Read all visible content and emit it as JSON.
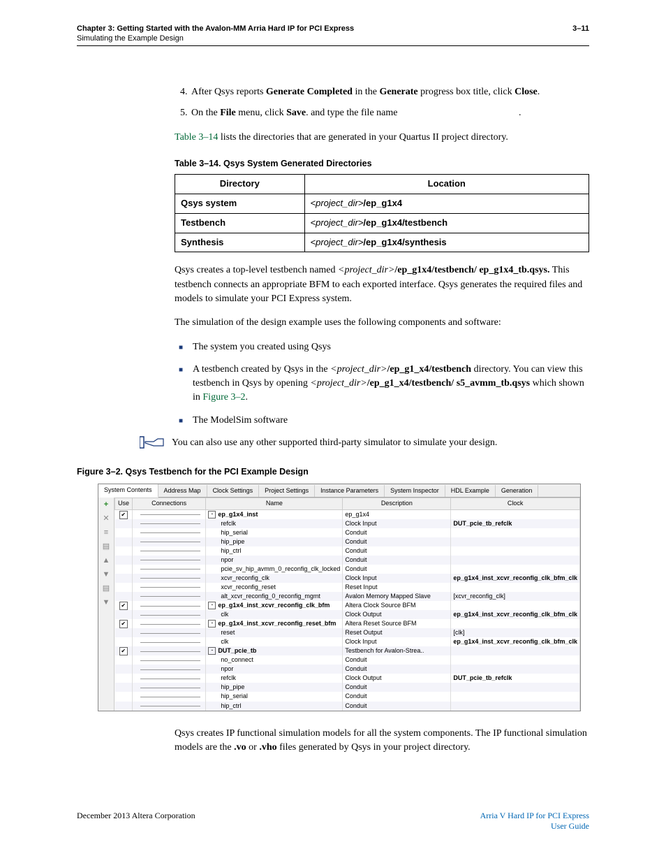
{
  "header": {
    "chapter_line": "Chapter 3:  Getting Started with the Avalon-MM Arria Hard IP for PCI Express",
    "sub_line": "Simulating the Example Design",
    "page_num": "3–11"
  },
  "steps": {
    "s4_a": "After Qsys reports ",
    "s4_b": "Generate Completed",
    "s4_c": " in the ",
    "s4_d": "Generate",
    "s4_e": " progress box title, click ",
    "s4_f": "Close",
    "s4_g": ".",
    "s5_a": "On the ",
    "s5_b": "File",
    "s5_c": " menu, click ",
    "s5_d": "Save",
    "s5_e": ". and type the file name",
    "s5_f": "."
  },
  "para_intro_a": "Table 3–14",
  "para_intro_b": " lists the directories that are generated in your Quartus II project directory.",
  "table_caption": "Table 3–14.  Qsys System Generated Directories",
  "table": {
    "h1": "Directory",
    "h2": "Location",
    "r1c1": "Qsys system",
    "r1c2a": "<project_dir>",
    "r1c2b": "/ep_g1x4",
    "r2c1": "Testbench",
    "r2c2a": "<project_dir>",
    "r2c2b": "/ep_g1x4/testbench",
    "r3c1": "Synthesis",
    "r3c2a": "<project_dir>",
    "r3c2b": "/ep_g1x4/synthesis"
  },
  "para2_a": "Qsys creates a top-level testbench named ",
  "para2_b": "<project_dir>",
  "para2_c": "/ep_g1x4/testbench/ ep_g1x4_tb.qsys.",
  "para2_d": " This testbench connects an appropriate BFM to each exported interface. Qsys generates the required files and models to simulate your PCI Express system.",
  "para3": "The simulation of the design example uses the following components and software:",
  "bullets": {
    "b1": "The system you created using Qsys",
    "b2_a": "A testbench created by Qsys in the ",
    "b2_b": "<project_dir>",
    "b2_c": "/ep_g1_x4/testbench",
    "b2_d": " directory. You can view this testbench in Qsys by opening ",
    "b2_e": "<project_dir>",
    "b2_f": "/ep_g1_x4/testbench/ s5_avmm_tb.qsys",
    "b2_g": " which shown in ",
    "b2_h": "Figure 3–2",
    "b2_i": ".",
    "b3": "The ModelSim software"
  },
  "note": "You can also use any other supported third-party simulator to simulate your design.",
  "fig_caption": "Figure 3–2.  Qsys Testbench for the PCI Example Design",
  "tabs": [
    "System Contents",
    "Address Map",
    "Clock Settings",
    "Project Settings",
    "Instance Parameters",
    "System Inspector",
    "HDL Example",
    "Generation"
  ],
  "cols": {
    "use": "Use",
    "conn": "Connections",
    "name": "Name",
    "desc": "Description",
    "clk": "Clock"
  },
  "toolbar_icons": [
    "+",
    "✕",
    "≡",
    "▤",
    "▲",
    "▼",
    "▤",
    "▼"
  ],
  "chart_data": {
    "type": "table",
    "rows": [
      {
        "use": true,
        "exp": "-",
        "name": "ep_g1x4_inst",
        "desc": "ep_g1x4",
        "clk": ""
      },
      {
        "name": "refclk",
        "desc": "Clock Input",
        "clk": "DUT_pcie_tb_refclk"
      },
      {
        "name": "hip_serial",
        "desc": "Conduit",
        "clk": ""
      },
      {
        "name": "hip_pipe",
        "desc": "Conduit",
        "clk": ""
      },
      {
        "name": "hip_ctrl",
        "desc": "Conduit",
        "clk": ""
      },
      {
        "name": "npor",
        "desc": "Conduit",
        "clk": ""
      },
      {
        "name": "pcie_sv_hip_avmm_0_reconfig_clk_locked",
        "desc": "Conduit",
        "clk": ""
      },
      {
        "name": "xcvr_reconfig_clk",
        "desc": "Clock Input",
        "clk": "ep_g1x4_inst_xcvr_reconfig_clk_bfm_clk"
      },
      {
        "name": "xcvr_reconfig_reset",
        "desc": "Reset Input",
        "clk": ""
      },
      {
        "name": "alt_xcvr_reconfig_0_reconfig_mgmt",
        "desc": "Avalon Memory Mapped Slave",
        "clk": "[xcvr_reconfig_clk]"
      },
      {
        "use": true,
        "exp": "-",
        "name": "ep_g1x4_inst_xcvr_reconfig_clk_bfm",
        "desc": "Altera Clock Source BFM",
        "clk": ""
      },
      {
        "name": "clk",
        "desc": "Clock Output",
        "clk": "ep_g1x4_inst_xcvr_reconfig_clk_bfm_clk"
      },
      {
        "use": true,
        "exp": "-",
        "name": "ep_g1x4_inst_xcvr_reconfig_reset_bfm",
        "desc": "Altera Reset Source BFM",
        "clk": ""
      },
      {
        "name": "reset",
        "desc": "Reset Output",
        "clk": "[clk]"
      },
      {
        "name": "clk",
        "desc": "Clock Input",
        "clk": "ep_g1x4_inst_xcvr_reconfig_clk_bfm_clk"
      },
      {
        "use": true,
        "exp": "-",
        "name": "DUT_pcie_tb",
        "desc": "Testbench for Avalon-Strea..",
        "clk": ""
      },
      {
        "name": "no_connect",
        "desc": "Conduit",
        "clk": ""
      },
      {
        "name": "npor",
        "desc": "Conduit",
        "clk": ""
      },
      {
        "name": "refclk",
        "desc": "Clock Output",
        "clk": "DUT_pcie_tb_refclk"
      },
      {
        "name": "hip_pipe",
        "desc": "Conduit",
        "clk": ""
      },
      {
        "name": "hip_serial",
        "desc": "Conduit",
        "clk": ""
      },
      {
        "name": "hip_ctrl",
        "desc": "Conduit",
        "clk": ""
      }
    ]
  },
  "para4_a": "Qsys creates IP functional simulation models for all the system components. The IP functional simulation models are the ",
  "para4_b": ".vo",
  "para4_c": " or ",
  "para4_d": ".vho",
  "para4_e": " files generated by Qsys in your project directory.",
  "footer": {
    "left": "December 2013   Altera Corporation",
    "right1": "Arria V Hard IP for PCI Express",
    "right2": "User Guide"
  }
}
